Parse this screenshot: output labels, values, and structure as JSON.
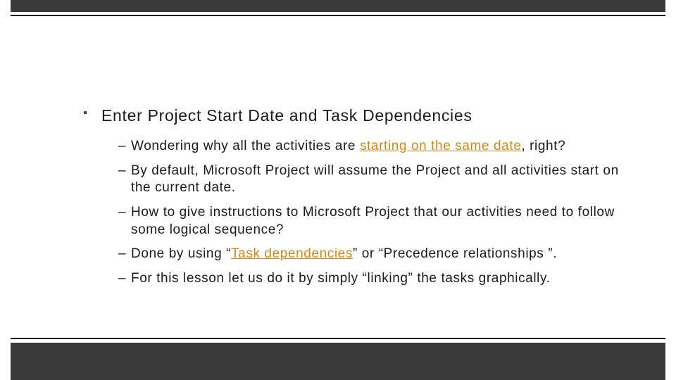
{
  "slide": {
    "heading": "Enter Project Start Date and Task Dependencies",
    "bullets": [
      {
        "pre": "Wondering why all the activities are ",
        "highlight": "starting on the same date",
        "post": ", right?"
      },
      {
        "pre": "By default, Microsoft Project will assume the Project and all activities start on the current date.",
        "highlight": "",
        "post": ""
      },
      {
        "pre": "How to give instructions to Microsoft Project that our activities need to follow some logical sequence?",
        "highlight": "",
        "post": ""
      },
      {
        "pre": "Done by using “",
        "highlight": "Task dependencies",
        "post": "” or “Precedence relationships ”."
      },
      {
        "pre": "For this lesson let us do it by simply “linking” the tasks graphically.",
        "highlight": "",
        "post": ""
      }
    ]
  }
}
